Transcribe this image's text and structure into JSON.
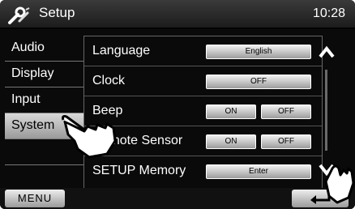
{
  "header": {
    "title": "Setup",
    "clock": "10:28",
    "icon": "wrench-screwdriver-icon"
  },
  "sidebar": {
    "items": [
      {
        "label": "Audio",
        "selected": false
      },
      {
        "label": "Display",
        "selected": false
      },
      {
        "label": "Input",
        "selected": false
      },
      {
        "label": "System",
        "selected": true
      },
      {
        "label": "",
        "selected": false
      },
      {
        "label": "",
        "selected": false
      }
    ]
  },
  "settings": {
    "language": {
      "label": "Language",
      "value": "English"
    },
    "clock": {
      "label": "Clock",
      "value": "OFF"
    },
    "beep": {
      "label": "Beep",
      "on": "ON",
      "off": "OFF"
    },
    "remote_sensor": {
      "label": "Remote Sensor",
      "on": "ON",
      "off": "OFF"
    },
    "setup_memory": {
      "label": "SETUP Memory",
      "value": "Enter"
    }
  },
  "footer": {
    "menu_label": "MENU",
    "back_icon": "return-arrow-icon"
  },
  "colors": {
    "background": "#0a0a0a",
    "selected_item": "#bdbdbd",
    "button": "#d6d6d6",
    "text": "#ffffff"
  }
}
